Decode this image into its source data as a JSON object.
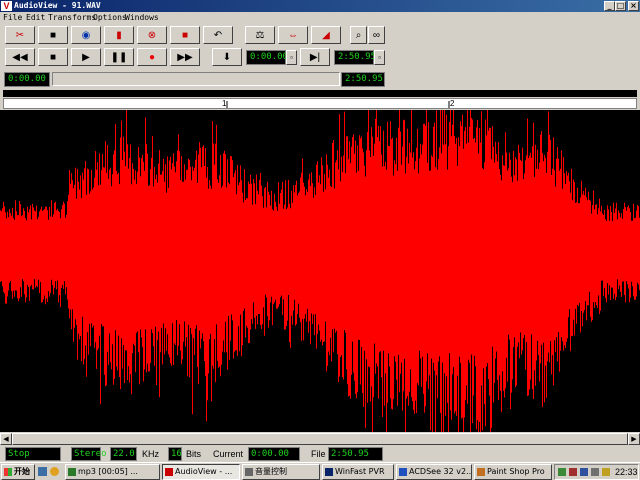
{
  "window": {
    "title": "AudioView - 91.WAV",
    "icon": "app-logo-icon"
  },
  "menu": [
    "File",
    "Edit",
    "Transforms",
    "Options",
    "Windows"
  ],
  "toolbar": {
    "position_display": "0:00.00",
    "end_display": "2:50.95",
    "current_display": "0:00.00"
  },
  "ruler": {
    "marks": [
      "1",
      "2"
    ]
  },
  "waveform": {
    "color": "#ff0000",
    "background": "#000000"
  },
  "status": {
    "state": "Stop",
    "channels": "Stereo",
    "rate_value": "22.0",
    "rate_unit": "KHz",
    "bits_value": "16",
    "bits_unit": "Bits",
    "current_label": "Current",
    "current_value": "0:00.00",
    "file_label": "File",
    "file_value": "2:50.95"
  },
  "taskbar": {
    "start_label": "开始",
    "tasks": [
      "mp3 [00:05] ...",
      "AudioView - ...",
      "音量控制",
      "WinFast PVR",
      "ACDSee 32 v2...",
      "Paint Shop Pro"
    ],
    "clock": "22:33"
  }
}
